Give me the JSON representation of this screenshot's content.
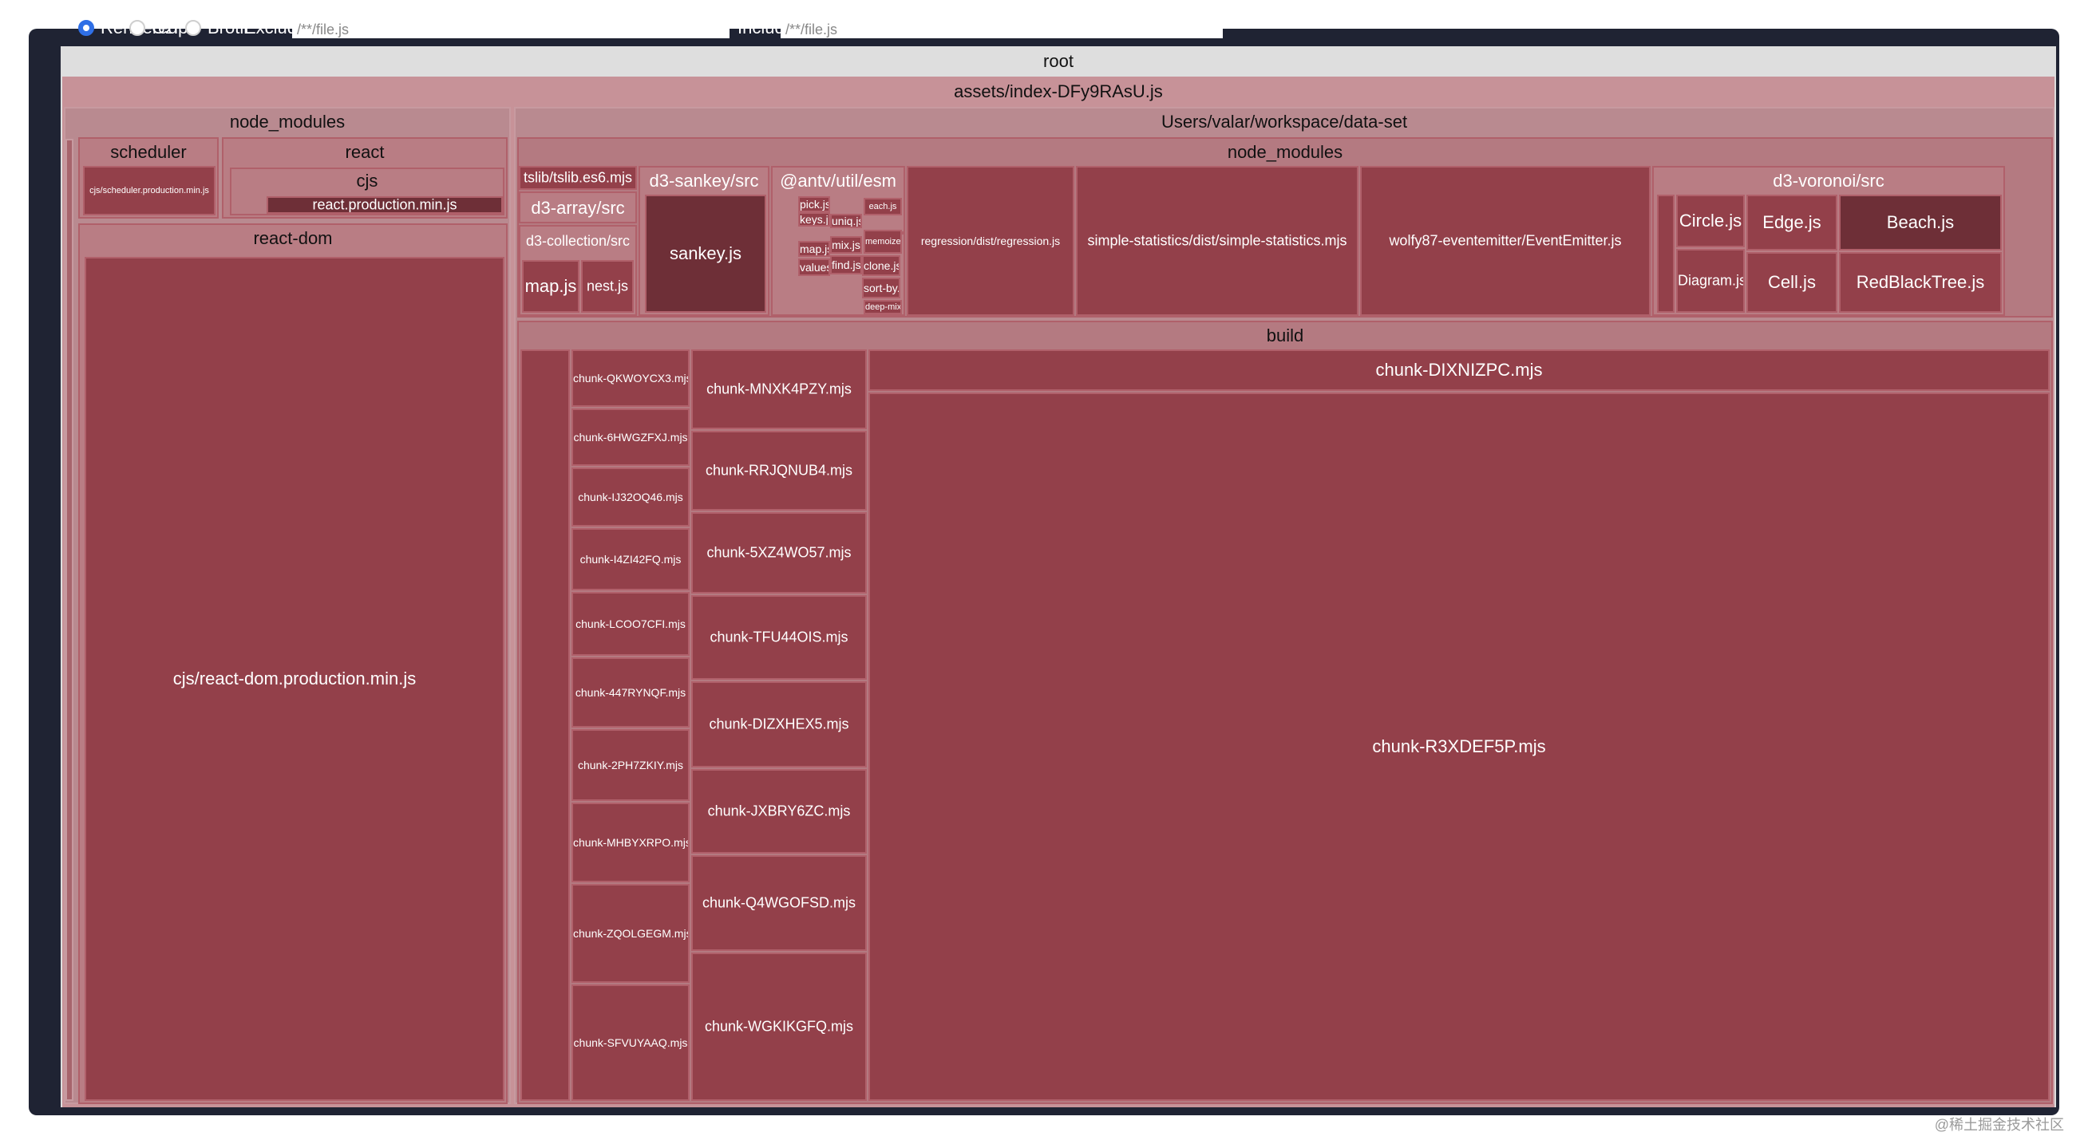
{
  "controls": {
    "size_options": [
      "Rendered",
      "Gzip",
      "Brotli"
    ],
    "selected": "Rendered",
    "exclude_label": "Exclude",
    "exclude_value": "/**/file.js",
    "include_label": "Include",
    "include_value": "/**/file.js"
  },
  "tree": {
    "root": "root",
    "bundle": "assets/index-DFy9RAsU.js",
    "node_modules": {
      "label": "node_modules",
      "scheduler": "scheduler",
      "scheduler_file": "cjs/scheduler.production.min.js",
      "react": "react",
      "react_cjs": "cjs",
      "react_file": "react.production.min.js",
      "react_dom": "react-dom",
      "react_dom_file": "cjs/react-dom.production.min.js"
    },
    "workspace": {
      "label": "Users/valar/workspace/data-set",
      "node_modules": "node_modules",
      "tslib": "tslib/tslib.es6.mjs",
      "d3_array": "d3-array/src",
      "d3_collection": "d3-collection/src",
      "map_js": "map.js",
      "nest_js": "nest.js",
      "d3_sankey": "d3-sankey/src",
      "sankey_js": "sankey.js",
      "antv_util": "@antv/util/esm",
      "antv_files": [
        "pick.js",
        "keys.js",
        "uniq.js",
        "map.js",
        "mix.js",
        "values.js",
        "find.js",
        "clone.js",
        "sort-by.js",
        "memoize.js",
        "each.js",
        "deep-mix.js"
      ],
      "regression": "regression/dist/regression.js",
      "simple_stats": "simple-statistics/dist/simple-statistics.mjs",
      "eventemitter": "wolfy87-eventemitter/EventEmitter.js",
      "d3_voronoi": "d3-voronoi/src",
      "voronoi_files": [
        "Circle.js",
        "Edge.js",
        "Beach.js",
        "Diagram.js",
        "Cell.js",
        "RedBlackTree.js"
      ],
      "build": "build",
      "chunks_col1": [
        "chunk-QKWOYCX3.mjs",
        "chunk-6HWGZFXJ.mjs",
        "chunk-IJ32OQ46.mjs",
        "chunk-I4ZI42FQ.mjs",
        "chunk-LCOO7CFI.mjs",
        "chunk-447RYNQF.mjs",
        "chunk-2PH7ZKIY.mjs",
        "chunk-MHBYXRPO.mjs",
        "chunk-ZQOLGEGM.mjs",
        "chunk-SFVUYAAQ.mjs"
      ],
      "chunks_col2": [
        "chunk-MNXK4PZY.mjs",
        "chunk-RRJQNUB4.mjs",
        "chunk-5XZ4WO57.mjs",
        "chunk-TFU44OIS.mjs",
        "chunk-DIZXHEX5.mjs",
        "chunk-JXBRY6ZC.mjs",
        "chunk-Q4WGOFSD.mjs",
        "chunk-WGKIKGFQ.mjs"
      ],
      "chunk_dixn": "chunk-DIXNIZPC.mjs",
      "chunk_r3x": "chunk-R3XDEF5P.mjs"
    }
  },
  "watermark": "@稀土掘金技术社区",
  "colors": {
    "frame": "#1f2333",
    "cell": "#93404a",
    "header_light": "#d4a1a7",
    "accent_radio": "#2f6fe6"
  }
}
